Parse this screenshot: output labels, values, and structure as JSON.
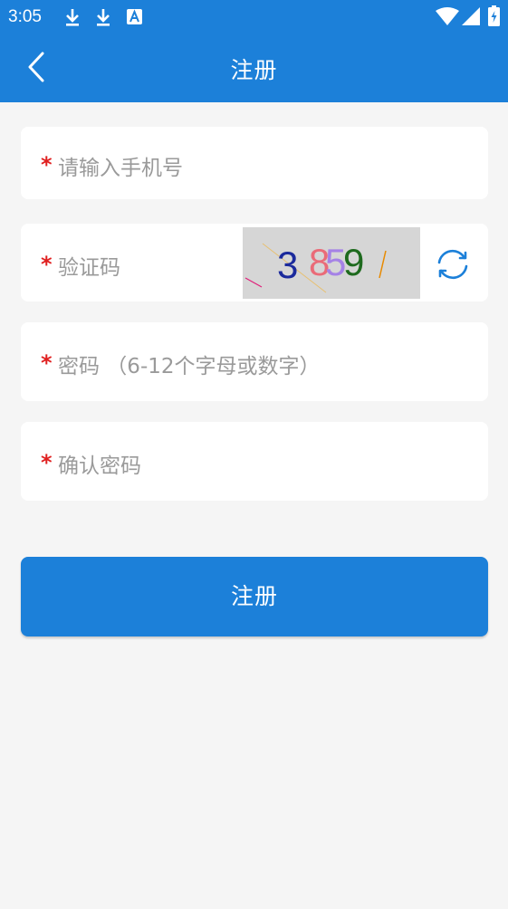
{
  "status_bar": {
    "time": "3:05",
    "icons": [
      "download-icon",
      "download-icon",
      "a-box-icon",
      "wifi-icon",
      "cell-signal-icon",
      "battery-charging-icon"
    ]
  },
  "header": {
    "title": "注册",
    "back_icon": "chevron-left-icon"
  },
  "form": {
    "phone": {
      "required_mark": "*",
      "placeholder": "请输入手机号"
    },
    "captcha": {
      "required_mark": "*",
      "placeholder": "验证码",
      "image_digits": [
        "3",
        "8",
        "5",
        "9"
      ],
      "image_digit_colors": [
        "#1b2a9c",
        "#ea6b78",
        "#a582e6",
        "#1e6a1e"
      ],
      "refresh_icon": "refresh-icon"
    },
    "password": {
      "required_mark": "*",
      "placeholder": "密码 （6-12个字母或数字）"
    },
    "confirm_password": {
      "required_mark": "*",
      "placeholder": "确认密码"
    }
  },
  "submit": {
    "label": "注册"
  },
  "colors": {
    "primary": "#1c80d9",
    "background": "#f5f5f5",
    "required": "#e02020",
    "placeholder": "#9a9a9a"
  }
}
